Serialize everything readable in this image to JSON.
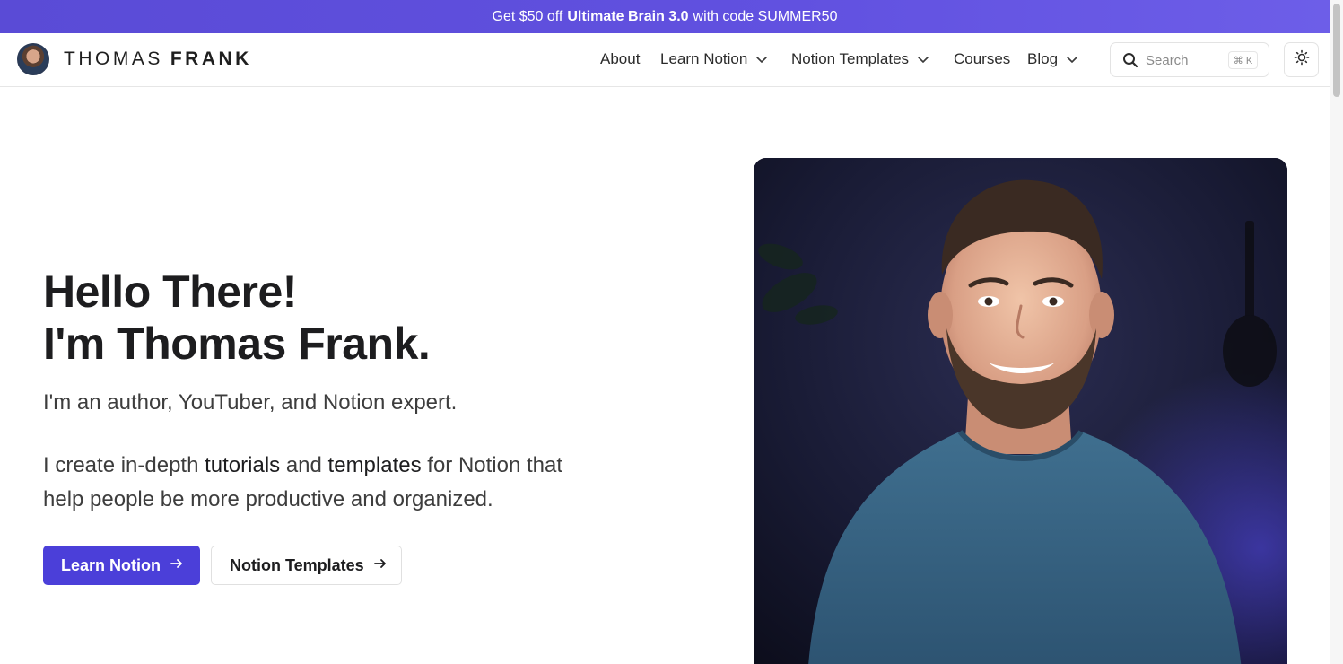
{
  "promo": {
    "prefix": "Get $50 off",
    "product": "Ultimate Brain 3.0",
    "suffix": "with code SUMMER50"
  },
  "header": {
    "logo_first": "THOMAS",
    "logo_last": "FRANK",
    "nav": {
      "about": "About",
      "learn_notion": "Learn Notion",
      "notion_templates": "Notion Templates",
      "courses": "Courses",
      "blog": "Blog"
    },
    "search": {
      "placeholder": "Search",
      "shortcut": "⌘ K"
    }
  },
  "hero": {
    "title_line1": "Hello There!",
    "title_line2": "I'm Thomas Frank.",
    "subtitle": "I'm an author, YouTuber, and Notion expert.",
    "desc_part1": "I create in-depth ",
    "desc_link1": "tutorials",
    "desc_part2": " and ",
    "desc_link2": "templates",
    "desc_part3": " for Notion that help people be more productive and organized.",
    "primary_button": "Learn Notion",
    "secondary_button": "Notion Templates"
  },
  "colors": {
    "accent": "#4b3fd9",
    "banner": "#5a4bd6",
    "shirt": "#3f6f8f"
  }
}
